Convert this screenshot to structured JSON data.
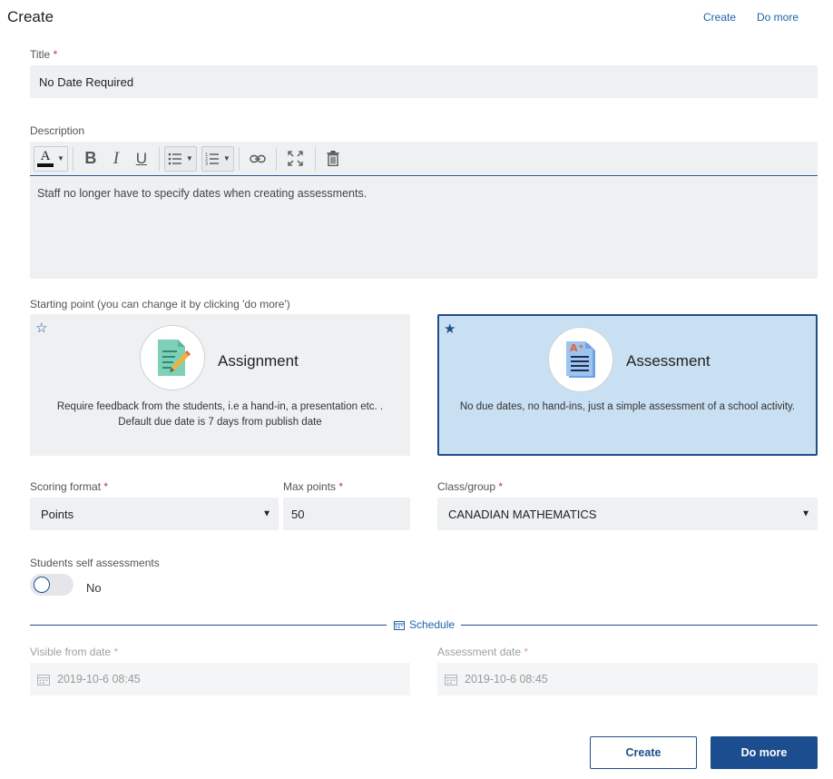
{
  "header": {
    "title": "Create",
    "links": {
      "create": "Create",
      "do_more": "Do more"
    }
  },
  "title_field": {
    "label": "Title",
    "required": "*",
    "value": "No Date Required"
  },
  "description": {
    "label": "Description",
    "toolbar": {
      "color_letter": "A",
      "bold": "B",
      "italic": "I",
      "underline": "U"
    },
    "value": "Staff no longer have to specify dates when creating assessments."
  },
  "starting_point": {
    "label": "Starting point (you can change it by clicking 'do more')",
    "cards": [
      {
        "name": "Assignment",
        "desc_line1": "Require feedback from the students, i.e a hand-in, a presentation etc. .",
        "desc_line2": "Default due date is 7 days from publish date",
        "star": "☆",
        "selected": false
      },
      {
        "name": "Assessment",
        "desc_line1": "No due dates, no hand-ins, just a simple assessment of a school activity.",
        "star": "★",
        "selected": true
      }
    ]
  },
  "scoring": {
    "label": "Scoring format",
    "required": "*",
    "value": "Points"
  },
  "max_points": {
    "label": "Max points",
    "required": "*",
    "value": "50"
  },
  "class_group": {
    "label": "Class/group",
    "required": "*",
    "value": "CANADIAN MATHEMATICS"
  },
  "self_assessment": {
    "label": "Students self assessments",
    "state": "No",
    "enabled": false
  },
  "schedule": {
    "label": "Schedule",
    "visible_from": {
      "label": "Visible from date",
      "required": "*",
      "value": "2019-10-6 08:45"
    },
    "assessment_date": {
      "label": "Assessment date",
      "required": "*",
      "value": "2019-10-6 08:45"
    }
  },
  "footer": {
    "create": "Create",
    "do_more": "Do more"
  },
  "colors": {
    "accent": "#1e4e8c",
    "selected_card": "#c9dff2",
    "field_bg": "#eef0f2"
  }
}
